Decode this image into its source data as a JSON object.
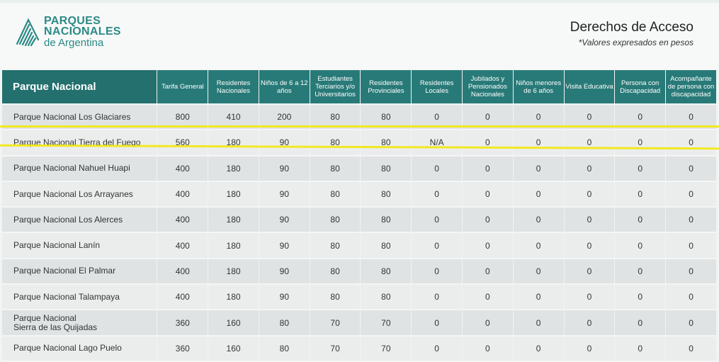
{
  "header": {
    "logo": {
      "line1": "PARQUES",
      "line2": "NACIONALES",
      "line3": "de Argentina"
    },
    "title": "Derechos de Acceso",
    "subtitle": "*Valores expresados en pesos"
  },
  "colors": {
    "brand": "#287a78",
    "highlight": "#f2e80a"
  },
  "table": {
    "columns": [
      "Parque Nacional",
      "Tarifa General",
      "Residentes Nacionales",
      "Niños de 6 a 12 años",
      "Estudiantes Terciarios y/o Universitarios",
      "Residentes Provinciales",
      "Residentes Locales",
      "Jubilados y Pensionados Nacionales",
      "Niños menores de 6 años",
      "Visita Educativa",
      "Persona con Discapacidad",
      "Acompañante de persona con discapacidad"
    ],
    "rows": [
      [
        "Parque Nacional Los Glaciares",
        "800",
        "410",
        "200",
        "80",
        "80",
        "0",
        "0",
        "0",
        "0",
        "0",
        "0"
      ],
      [
        "Parque Nacional Tierra del Fuego",
        "560",
        "180",
        "90",
        "80",
        "80",
        "N/A",
        "0",
        "0",
        "0",
        "0",
        "0"
      ],
      [
        "Parque Nacional Nahuel Huapi",
        "400",
        "180",
        "90",
        "80",
        "80",
        "0",
        "0",
        "0",
        "0",
        "0",
        "0"
      ],
      [
        "Parque Nacional Los Arrayanes",
        "400",
        "180",
        "90",
        "80",
        "80",
        "0",
        "0",
        "0",
        "0",
        "0",
        "0"
      ],
      [
        "Parque Nacional Los Alerces",
        "400",
        "180",
        "90",
        "80",
        "80",
        "0",
        "0",
        "0",
        "0",
        "0",
        "0"
      ],
      [
        "Parque Nacional Lanín",
        "400",
        "180",
        "90",
        "80",
        "80",
        "0",
        "0",
        "0",
        "0",
        "0",
        "0"
      ],
      [
        "Parque Nacional El Palmar",
        "400",
        "180",
        "90",
        "80",
        "80",
        "0",
        "0",
        "0",
        "0",
        "0",
        "0"
      ],
      [
        "Parque Nacional Talampaya",
        "400",
        "180",
        "90",
        "80",
        "80",
        "0",
        "0",
        "0",
        "0",
        "0",
        "0"
      ],
      [
        "Parque Nacional\nSierra de las Quijadas",
        "360",
        "160",
        "80",
        "70",
        "70",
        "0",
        "0",
        "0",
        "0",
        "0",
        "0"
      ],
      [
        "Parque Nacional Lago Puelo",
        "360",
        "160",
        "80",
        "70",
        "70",
        "0",
        "0",
        "0",
        "0",
        "0",
        "0"
      ]
    ]
  }
}
